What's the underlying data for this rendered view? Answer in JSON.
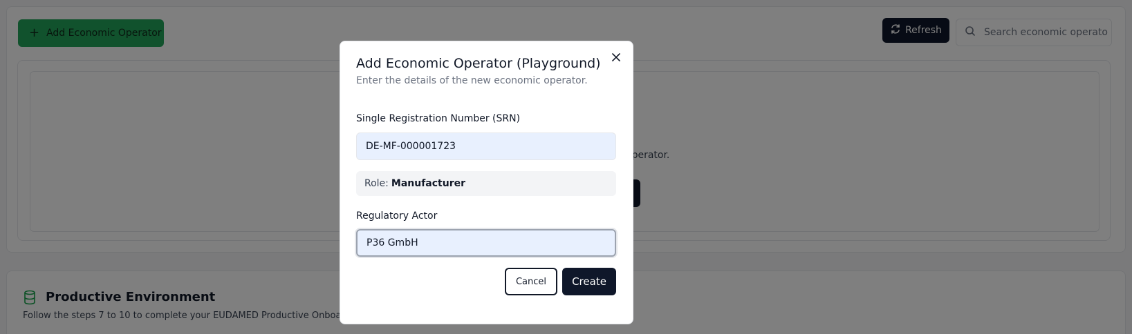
{
  "toolbar": {
    "add_label": "Add Economic Operator",
    "refresh_label": "Refresh",
    "search_placeholder": "Search economic operato"
  },
  "empty_state": {
    "text_fragment": "operator."
  },
  "productive": {
    "title": "Productive Environment",
    "subtitle": "Follow the steps 7 to 10 to complete your EUDAMED Productive Onboa"
  },
  "dialog": {
    "title": "Add Economic Operator (Playground)",
    "description": "Enter the details of the new economic operator.",
    "srn_label": "Single Registration Number (SRN)",
    "srn_value": "DE-MF-000001723",
    "role_prefix": "Role:",
    "role_value": "Manufacturer",
    "actor_label": "Regulatory Actor",
    "actor_value": "P36 GmbH",
    "cancel_label": "Cancel",
    "create_label": "Create"
  },
  "colors": {
    "primary_dark": "#0f172a",
    "add_green": "#22a45a",
    "input_fill": "#e8f0fe"
  },
  "icons": {
    "add": "plus-icon",
    "refresh": "refresh-icon",
    "search": "search-icon",
    "close": "close-icon",
    "environment": "database-icon"
  }
}
